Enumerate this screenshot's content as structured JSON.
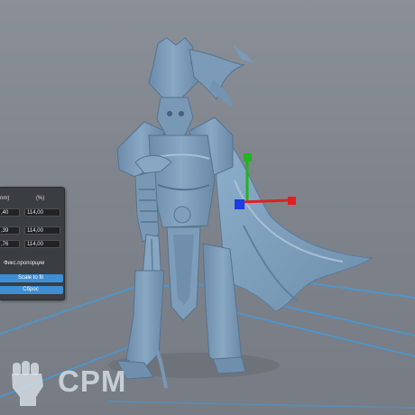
{
  "colors": {
    "background": "#848992",
    "model": "#7fa0be",
    "grid": "#4f95c8",
    "axis_x": "#e0201f",
    "axis_y": "#22b422",
    "axis_z": "#1a3ce0",
    "panel": "#3a3d42",
    "button": "#3c8fd6"
  },
  "scale_panel": {
    "col_mm": "nm)",
    "col_pct": "(%)",
    "rows": [
      {
        "mm": ",40",
        "pct": "114,00"
      },
      {
        "mm": ",39",
        "pct": "114,00"
      },
      {
        "mm": ",76",
        "pct": "114,00"
      }
    ],
    "lock_proportions": "Фикс.пропорции",
    "scale_to_fit": "Scale to fit",
    "reset": "Сброс"
  },
  "watermark": {
    "text": "CPM",
    "icon": "raised-fist-icon"
  },
  "gizmo": {
    "icon": "move-gizmo-icon"
  }
}
